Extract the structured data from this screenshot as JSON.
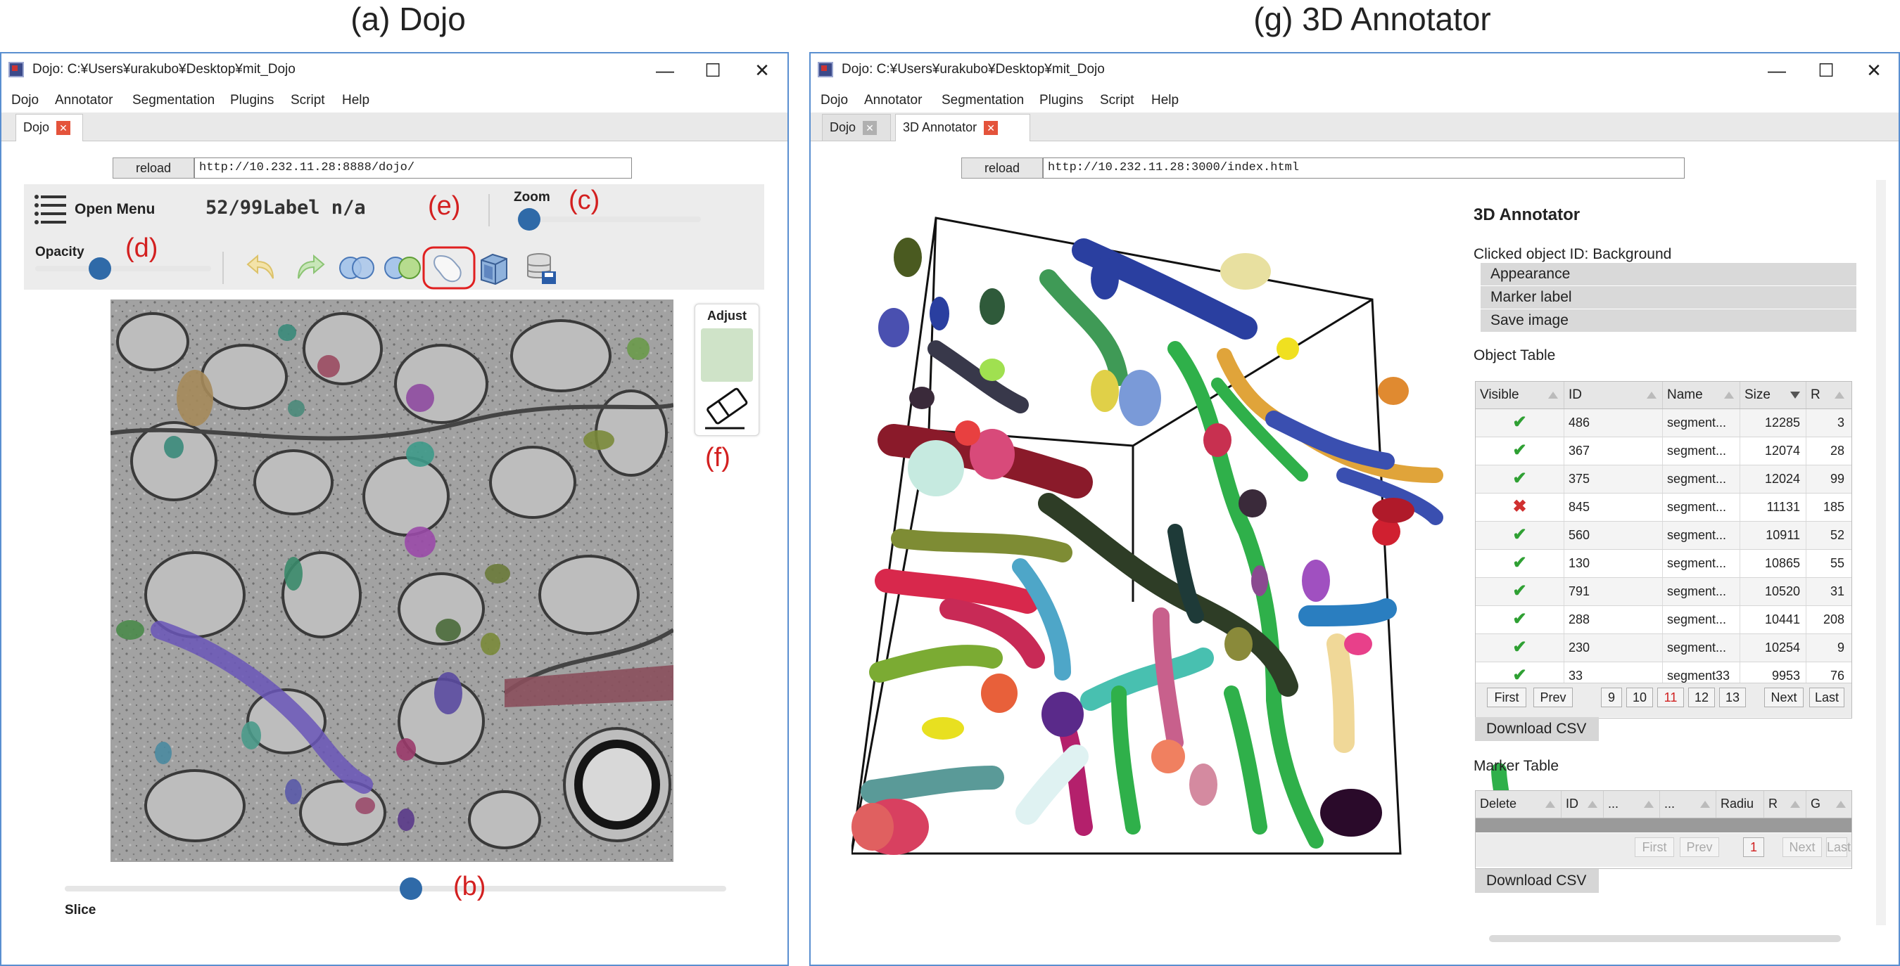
{
  "figure": {
    "left_caption": "(a) Dojo",
    "right_caption": "(g) 3D Annotator"
  },
  "left_window": {
    "title": "Dojo: C:¥Users¥urakubo¥Desktop¥mit_Dojo",
    "controls": {
      "minimize": "—",
      "maximize": "☐",
      "close": "✕"
    },
    "menu": [
      "Dojo",
      "Annotator",
      "Segmentation",
      "Plugins",
      "Script",
      "Help"
    ],
    "tab": {
      "label": "Dojo",
      "close": "✕"
    },
    "reload_label": "reload",
    "url": "http://10.232.11.28:8888/dojo/",
    "toolbar": {
      "menu_label": "Open Menu",
      "status": "52/99Label n/a",
      "zoom_label": "Zoom",
      "opacity_label": "Opacity"
    },
    "adjust": {
      "label": "Adjust",
      "swatch_color": "#cfe3c8"
    },
    "slice_label": "Slice",
    "annotations": {
      "b": "(b)",
      "c": "(c)",
      "d": "(d)",
      "e": "(e)",
      "f": "(f)"
    },
    "icons": [
      "undo-icon",
      "redo-icon",
      "merge-icon",
      "split-icon",
      "paint-icon",
      "3d-cube-icon",
      "save-database-icon",
      "eraser-icon",
      "menu-icon"
    ]
  },
  "right_window": {
    "title": "Dojo: C:¥Users¥urakubo¥Desktop¥mit_Dojo",
    "controls": {
      "minimize": "—",
      "maximize": "☐",
      "close": "✕"
    },
    "menu": [
      "Dojo",
      "Annotator",
      "Segmentation",
      "Plugins",
      "Script",
      "Help"
    ],
    "tabs": [
      {
        "label": "Dojo",
        "close": "✕"
      },
      {
        "label": "3D Annotator",
        "close": "✕"
      }
    ],
    "reload_label": "reload",
    "url": "http://10.232.11.28:3000/index.html",
    "panel": {
      "title": "3D Annotator",
      "clicked": "Clicked object ID: Background",
      "accordion": [
        "Appearance",
        "Marker label",
        "Save image"
      ],
      "object_table_label": "Object Table",
      "object_columns": [
        "Visible",
        "ID",
        "Name",
        "Size",
        "R"
      ],
      "object_rows": [
        {
          "visible": "✔",
          "id": "486",
          "name": "segment...",
          "size": "12285",
          "r": "3"
        },
        {
          "visible": "✔",
          "id": "367",
          "name": "segment...",
          "size": "12074",
          "r": "28"
        },
        {
          "visible": "✔",
          "id": "375",
          "name": "segment...",
          "size": "12024",
          "r": "99"
        },
        {
          "visible": "✖",
          "id": "845",
          "name": "segment...",
          "size": "11131",
          "r": "185"
        },
        {
          "visible": "✔",
          "id": "560",
          "name": "segment...",
          "size": "10911",
          "r": "52"
        },
        {
          "visible": "✔",
          "id": "130",
          "name": "segment...",
          "size": "10865",
          "r": "55"
        },
        {
          "visible": "✔",
          "id": "791",
          "name": "segment...",
          "size": "10520",
          "r": "31"
        },
        {
          "visible": "✔",
          "id": "288",
          "name": "segment...",
          "size": "10441",
          "r": "208"
        },
        {
          "visible": "✔",
          "id": "230",
          "name": "segment...",
          "size": "10254",
          "r": "9"
        },
        {
          "visible": "✔",
          "id": "33",
          "name": "segment33",
          "size": "9953",
          "r": "76"
        }
      ],
      "object_pager": [
        "First",
        "Prev",
        "9",
        "10",
        "11",
        "12",
        "13",
        "Next",
        "Last"
      ],
      "object_pager_current": "11",
      "download_csv": "Download CSV",
      "marker_table_label": "Marker Table",
      "marker_columns": [
        "Delete",
        "ID",
        "...",
        "...",
        "Radiu",
        "R",
        "G"
      ],
      "marker_pager": [
        "First",
        "Prev",
        "1",
        "Next",
        "Last"
      ],
      "download_csv_2": "Download CSV"
    }
  }
}
